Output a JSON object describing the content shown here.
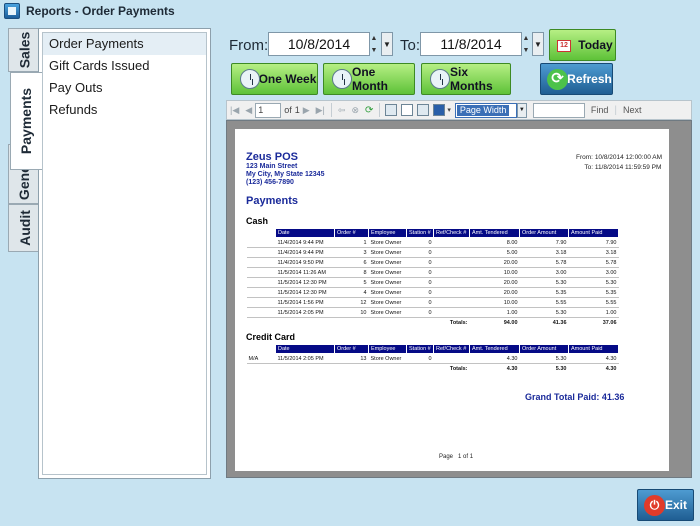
{
  "window": {
    "title": "Reports - Order Payments"
  },
  "tabs": [
    {
      "label": "Sales"
    },
    {
      "label": "Payments"
    },
    {
      "label": "General"
    },
    {
      "label": "Audit"
    }
  ],
  "menu": {
    "items": [
      {
        "label": "Order Payments"
      },
      {
        "label": "Gift Cards Issued"
      },
      {
        "label": "Pay Outs"
      },
      {
        "label": "Refunds"
      }
    ]
  },
  "filters": {
    "from_label": "From:",
    "from_value": "10/8/2014",
    "to_label": "To:",
    "to_value": "11/8/2014"
  },
  "buttons": {
    "today": "Today",
    "one_week": "One Week",
    "one_month": "One Month",
    "six_months": "Six Months",
    "refresh": "Refresh",
    "exit": "Exit",
    "calendar_glyph": "12"
  },
  "viewer_toolbar": {
    "page_current": "1",
    "page_of": "of",
    "page_total": "1",
    "zoom_value": "Page Width",
    "find_label": "Find",
    "next_label": "Next"
  },
  "report": {
    "company_name": "Zeus POS",
    "address1": "123 Main Street",
    "address2": "My City, My State 12345",
    "phone": "(123) 456-7890",
    "from_label": "From:",
    "from_value": "10/8/2014 12:00:00 AM",
    "to_label": "To:",
    "to_value": "11/8/2014 11:59:59 PM",
    "title": "Payments",
    "columns": [
      "Date",
      "Order #",
      "Employee",
      "Station #",
      "Ref/Check #",
      "Amt. Tendered",
      "Order Amount",
      "Amount Paid"
    ],
    "totals_label": "Totals:",
    "cash": {
      "title": "Cash",
      "rows": [
        {
          "type": "",
          "date": "11/4/2014 9:44 PM",
          "order": "1",
          "employee": "Store Owner",
          "station": "0",
          "ref": "",
          "tendered": "8.00",
          "amount": "7.90",
          "paid": "7.90"
        },
        {
          "type": "",
          "date": "11/4/2014 9:44 PM",
          "order": "3",
          "employee": "Store Owner",
          "station": "0",
          "ref": "",
          "tendered": "5.00",
          "amount": "3.18",
          "paid": "3.18"
        },
        {
          "type": "",
          "date": "11/4/2014 9:50 PM",
          "order": "6",
          "employee": "Store Owner",
          "station": "0",
          "ref": "",
          "tendered": "20.00",
          "amount": "5.78",
          "paid": "5.78"
        },
        {
          "type": "",
          "date": "11/5/2014 11:26 AM",
          "order": "8",
          "employee": "Store Owner",
          "station": "0",
          "ref": "",
          "tendered": "10.00",
          "amount": "3.00",
          "paid": "3.00"
        },
        {
          "type": "",
          "date": "11/5/2014 12:30 PM",
          "order": "5",
          "employee": "Store Owner",
          "station": "0",
          "ref": "",
          "tendered": "20.00",
          "amount": "5.30",
          "paid": "5.30"
        },
        {
          "type": "",
          "date": "11/5/2014 12:30 PM",
          "order": "4",
          "employee": "Store Owner",
          "station": "0",
          "ref": "",
          "tendered": "20.00",
          "amount": "5.35",
          "paid": "5.35"
        },
        {
          "type": "",
          "date": "11/5/2014 1:56 PM",
          "order": "12",
          "employee": "Store Owner",
          "station": "0",
          "ref": "",
          "tendered": "10.00",
          "amount": "5.55",
          "paid": "5.55"
        },
        {
          "type": "",
          "date": "11/5/2014 2:05 PM",
          "order": "10",
          "employee": "Store Owner",
          "station": "0",
          "ref": "",
          "tendered": "1.00",
          "amount": "5.30",
          "paid": "1.00"
        }
      ],
      "totals": {
        "tendered": "94.00",
        "amount": "41.36",
        "paid": "37.06"
      }
    },
    "credit": {
      "title": "Credit Card",
      "rows": [
        {
          "type": "M/A",
          "date": "11/5/2014 2:05 PM",
          "order": "13",
          "employee": "Store Owner",
          "station": "0",
          "ref": "",
          "tendered": "4.30",
          "amount": "5.30",
          "paid": "4.30"
        }
      ],
      "totals": {
        "tendered": "4.30",
        "amount": "5.30",
        "paid": "4.30"
      }
    },
    "grand_total_label": "Grand Total Paid:",
    "grand_total_value": "41.36",
    "page_label": "Page",
    "page_value": "1 of 1"
  }
}
